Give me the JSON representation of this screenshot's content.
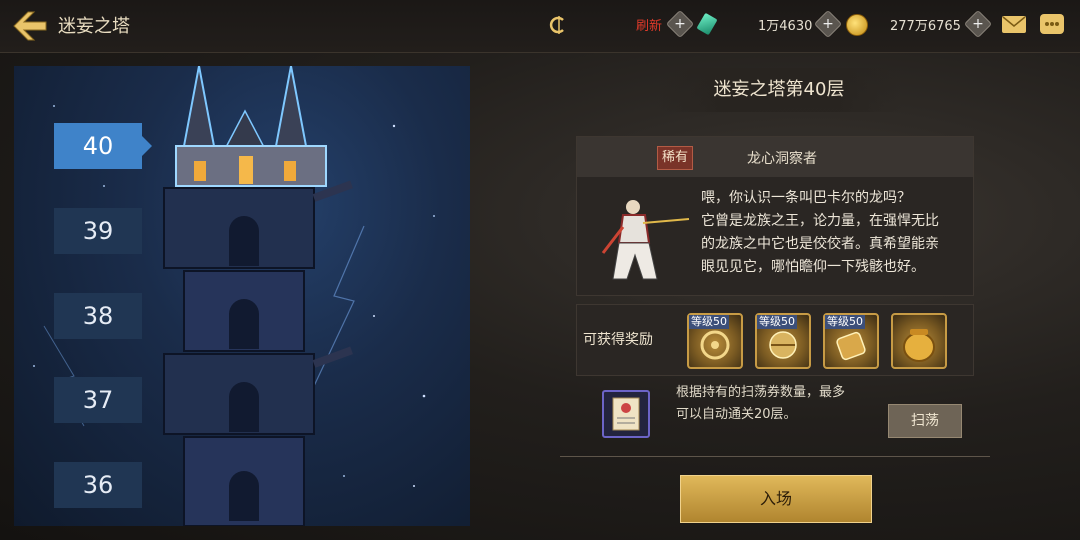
{
  "header": {
    "title": "迷妄之塔",
    "refresh_label": "刷新",
    "gem_amount": "1万4630",
    "gold_amount": "277万6765"
  },
  "tower": {
    "floors": [
      "40",
      "39",
      "38",
      "37",
      "36"
    ],
    "selected_floor": "40"
  },
  "panel": {
    "floor_title": "迷妄之塔第40层",
    "npc": {
      "rarity": "稀有",
      "name": "龙心洞察者",
      "dialog_lines": [
        "喂，你认识一条叫巴卡尔的龙吗？",
        "它曾是龙族之王，论力量，在强悍无比",
        "的龙族之中它也是佼佼者。真希望能亲",
        "眼见见它，哪怕瞻仰一下残骸也好。"
      ]
    },
    "rewards": {
      "label": "可获得奖励",
      "items": [
        {
          "badge": "等级50",
          "icon": "gear-material-icon"
        },
        {
          "badge": "等级50",
          "icon": "orb-material-icon"
        },
        {
          "badge": "等级50",
          "icon": "scroll-material-icon"
        },
        {
          "badge": "",
          "icon": "gold-pot-icon"
        }
      ]
    },
    "sweep": {
      "line1": "根据持有的扫荡券数量，最多",
      "line2": "可以自动通关20层。",
      "button": "扫荡"
    },
    "enter_button": "入场"
  },
  "colors": {
    "accent_gold": "#c79b45",
    "selected_floor_blue": "#3f83c9",
    "refresh_red": "#e03a2a"
  }
}
